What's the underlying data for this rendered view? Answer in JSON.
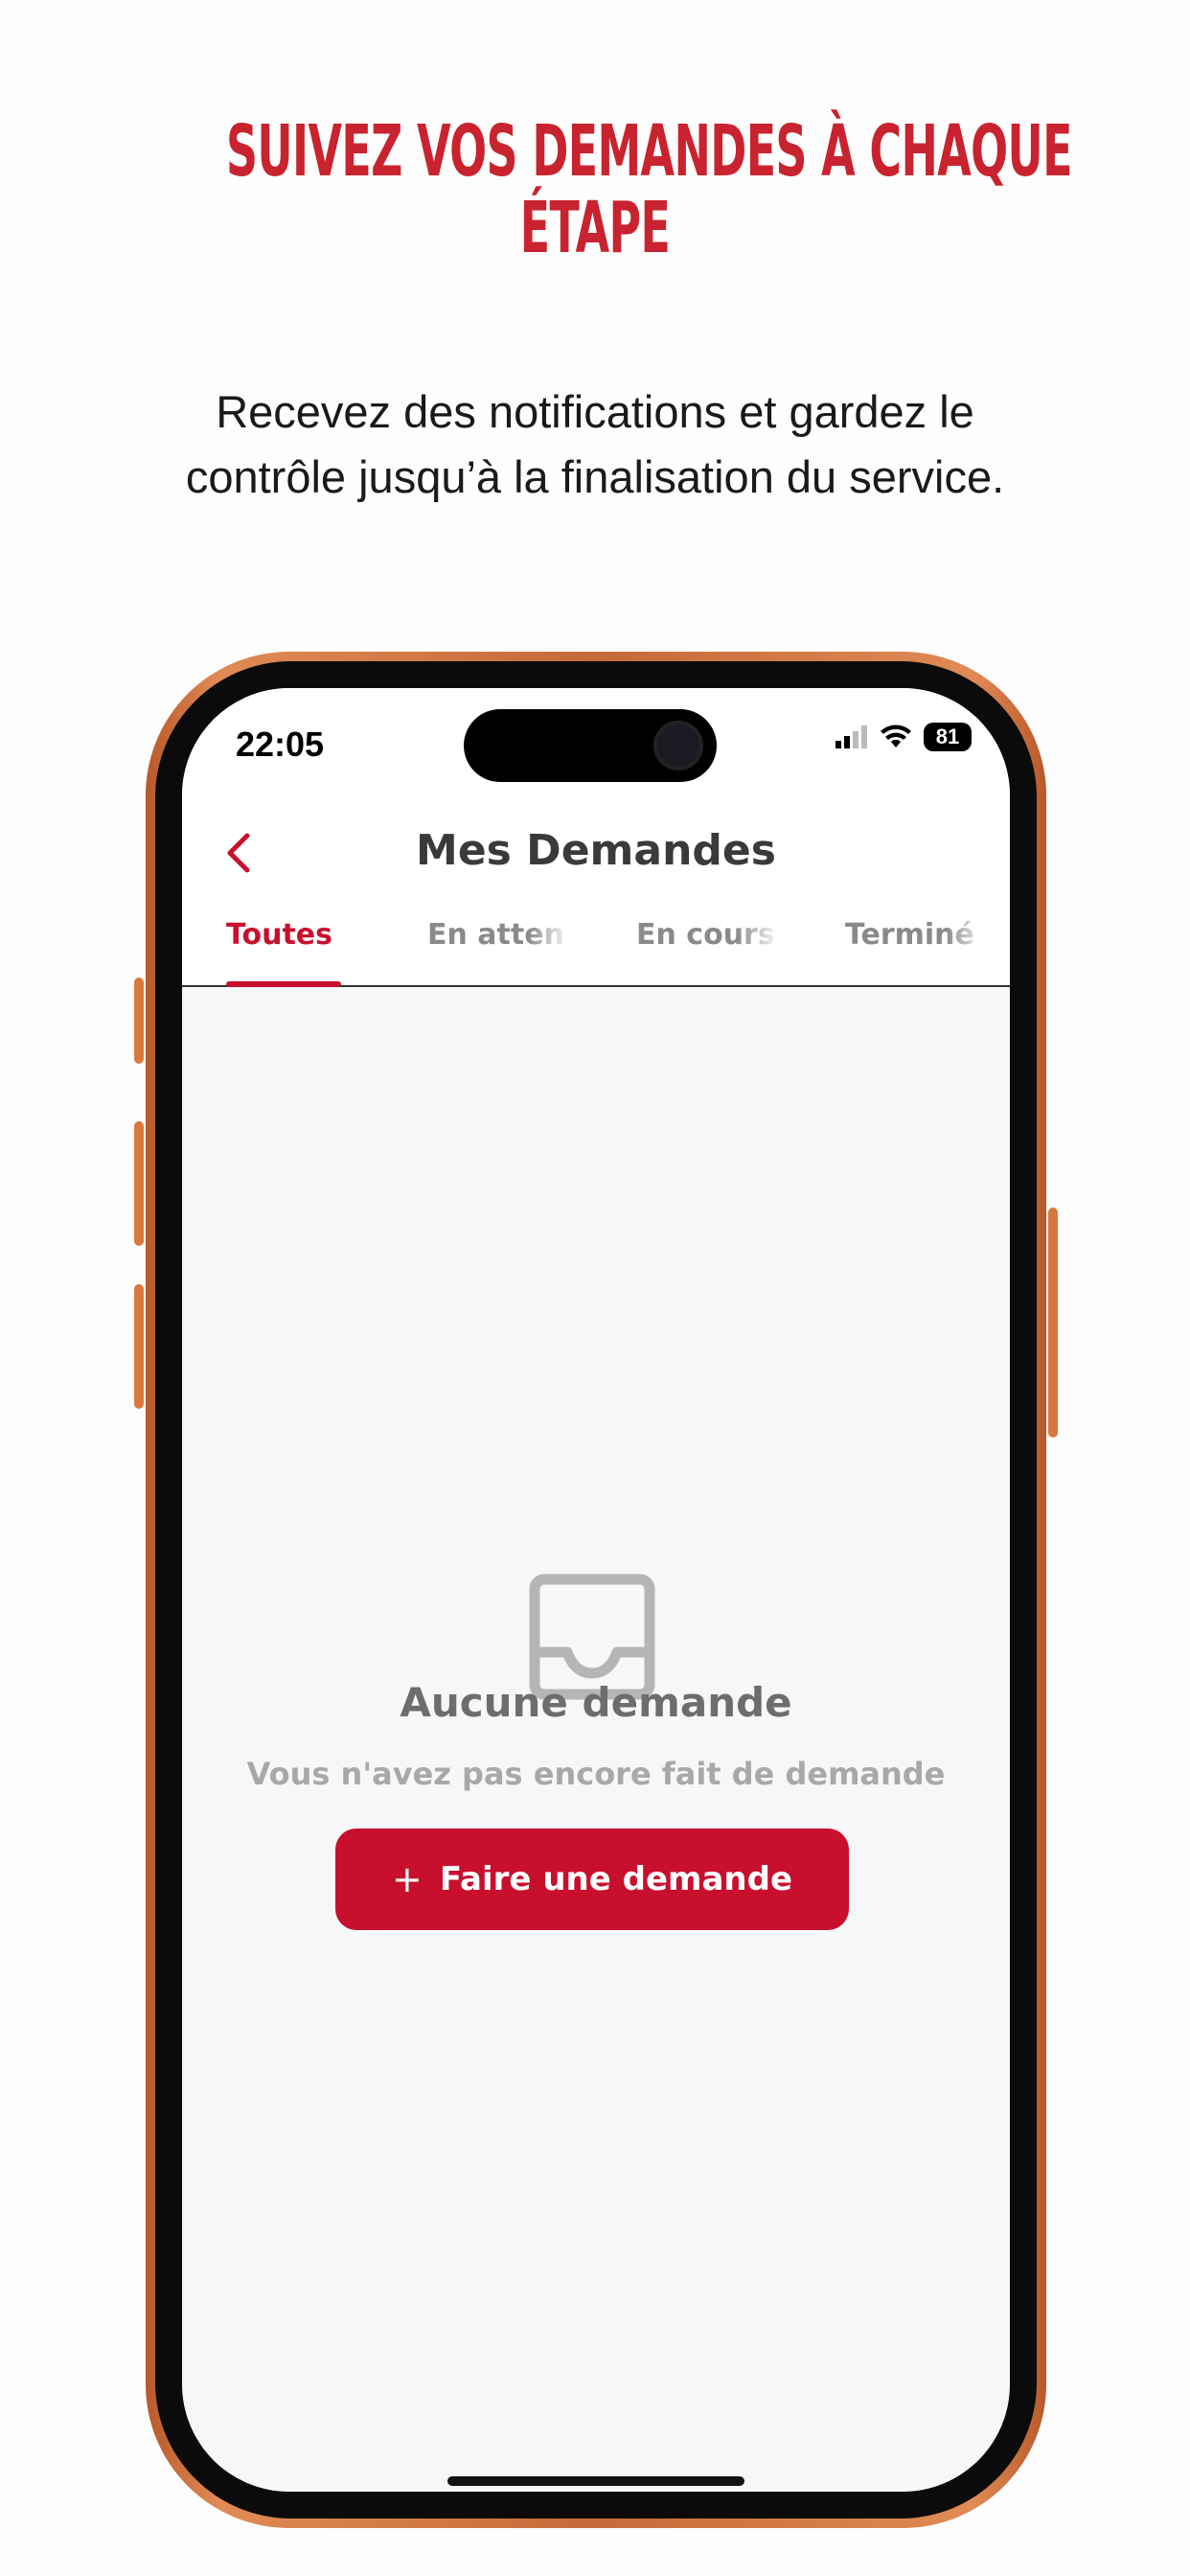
{
  "promo": {
    "headline_line1": "SUIVEZ VOS DEMANDES À CHAQUE",
    "headline_line2": "ÉTAPE",
    "subtitle_line1": "Recevez des notifications et gardez le",
    "subtitle_line2": "contrôle jusqu’à la finalisation du service."
  },
  "status_bar": {
    "time": "22:05",
    "battery": "81"
  },
  "nav": {
    "title": "Mes Demandes",
    "back_icon": "chevron-left-icon"
  },
  "tabs": [
    {
      "label": "Toutes",
      "active": true
    },
    {
      "label": "En atten",
      "active": false
    },
    {
      "label": "En cours",
      "active": false
    },
    {
      "label": "Terminé",
      "active": false
    }
  ],
  "empty_state": {
    "icon": "inbox-icon",
    "title": "Aucune demande",
    "subtitle": "Vous n'avez pas encore fait de demande",
    "cta_icon": "+",
    "cta_label": "Faire une demande"
  },
  "colors": {
    "accent": "#c8102e",
    "headline": "#c8232e",
    "phone_frame": "#d8783f"
  }
}
